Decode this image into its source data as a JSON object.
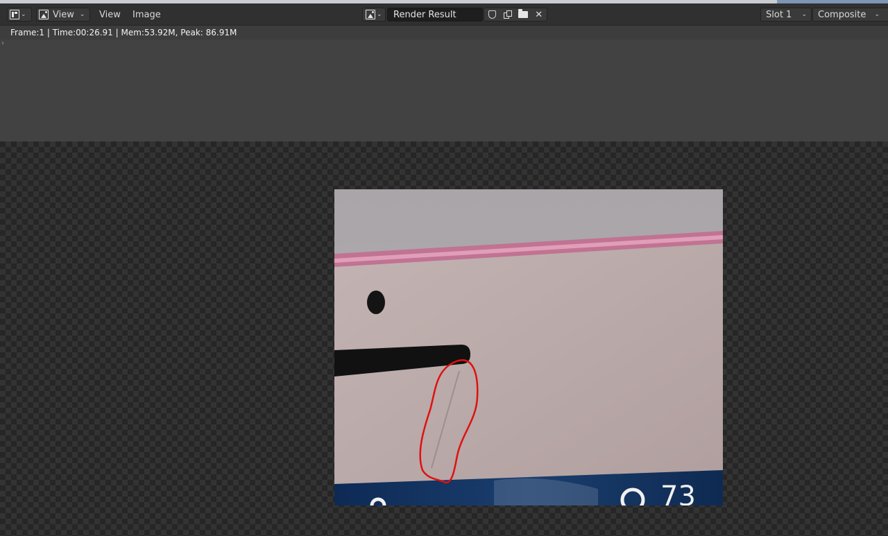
{
  "header": {
    "mode_label": "View",
    "menus": [
      "View",
      "Image"
    ],
    "image_name": "Render Result",
    "slot": "Slot 1",
    "layer": "Composite"
  },
  "info": {
    "text": "Frame:1 | Time:00:26.91 | Mem:53.92M, Peak: 86.91M"
  },
  "render": {
    "bottom_text": "73"
  },
  "colors": {
    "annotation": "#e01010",
    "pink_edge": "#c4678f",
    "panel_bg": "#b7a7a6"
  }
}
